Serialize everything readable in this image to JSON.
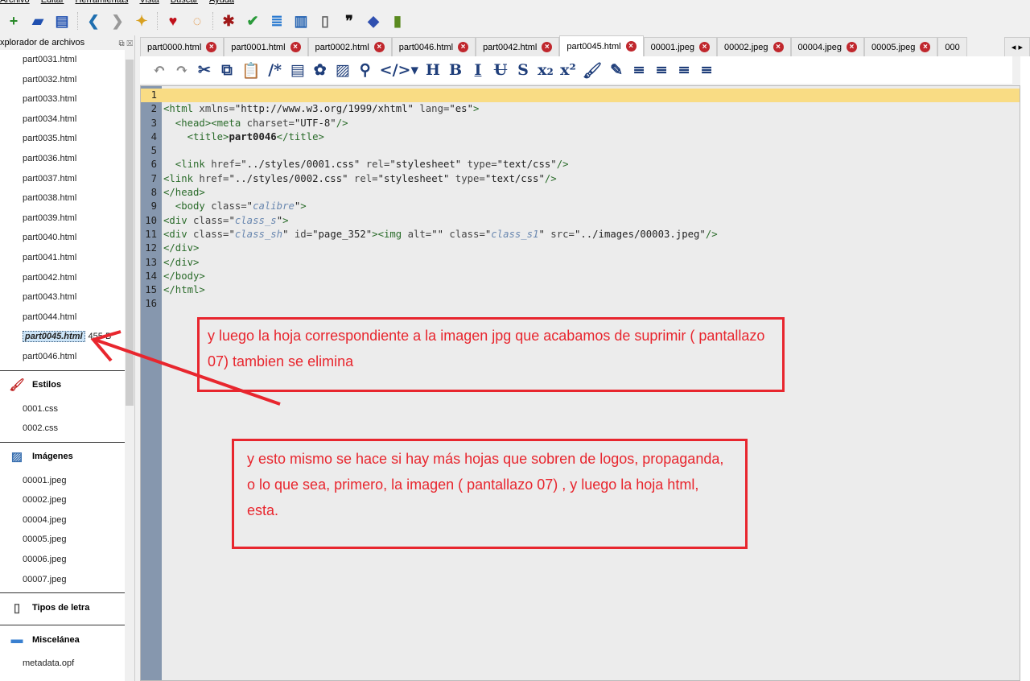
{
  "menu": [
    "Archivo",
    "Editar",
    "Herramientas",
    "Vista",
    "Buscar",
    "Ayuda"
  ],
  "toolbar": [
    {
      "icon": "new-file",
      "g": "+",
      "c": "#2a8a2a"
    },
    {
      "icon": "open-folder",
      "g": "▰",
      "c": "#2050b0"
    },
    {
      "icon": "save",
      "g": "▤",
      "c": "#2050b0"
    },
    {
      "icon": "back",
      "g": "❮",
      "c": "#1f6fb0"
    },
    {
      "icon": "forward",
      "g": "❯",
      "c": "#999"
    },
    {
      "icon": "pin",
      "g": "✦",
      "c": "#d8a020"
    },
    {
      "icon": "heart",
      "g": "♥",
      "c": "#c0101a"
    },
    {
      "icon": "lifebuoy",
      "g": "◌",
      "c": "#e08a30"
    },
    {
      "icon": "bug",
      "g": "✱",
      "c": "#a01818"
    },
    {
      "icon": "spellcheck",
      "g": "✔",
      "c": "#2a9a3a"
    },
    {
      "icon": "toc",
      "g": "≣",
      "c": "#2a7ad0"
    },
    {
      "icon": "book",
      "g": "▥",
      "c": "#2060b0"
    },
    {
      "icon": "font-file",
      "g": "▯",
      "c": "#666"
    },
    {
      "icon": "quote",
      "g": "❞",
      "c": "#111"
    },
    {
      "icon": "eraser",
      "g": "◆",
      "c": "#3050b0"
    },
    {
      "icon": "reports",
      "g": "▮",
      "c": "#5a8a20"
    }
  ],
  "sidebar": {
    "title": "xplorador de archivos",
    "html_files": [
      "part0031.html",
      "part0032.html",
      "part0033.html",
      "part0034.html",
      "part0035.html",
      "part0036.html",
      "part0037.html",
      "part0038.html",
      "part0039.html",
      "part0040.html",
      "part0041.html",
      "part0042.html",
      "part0043.html",
      "part0044.html"
    ],
    "selected": {
      "name": "part0045.html",
      "size": "455 B"
    },
    "after_selected": "part0046.html",
    "styles_label": "Estilos",
    "styles": [
      "0001.css",
      "0002.css"
    ],
    "images_label": "Imágenes",
    "images": [
      "00001.jpeg",
      "00002.jpeg",
      "00004.jpeg",
      "00005.jpeg",
      "00006.jpeg",
      "00007.jpeg"
    ],
    "fonts_label": "Tipos de letra",
    "misc_label": "Miscelánea",
    "misc": [
      "metadata.opf"
    ]
  },
  "tabs": [
    {
      "label": "part0000.html"
    },
    {
      "label": "part0001.html"
    },
    {
      "label": "part0002.html"
    },
    {
      "label": "part0046.html"
    },
    {
      "label": "part0042.html"
    },
    {
      "label": "part0045.html",
      "active": true
    },
    {
      "label": "00001.jpeg"
    },
    {
      "label": "00002.jpeg"
    },
    {
      "label": "00004.jpeg"
    },
    {
      "label": "00005.jpeg"
    },
    {
      "label": "000"
    }
  ],
  "editor_toolbar": [
    "↶",
    "↷",
    "✂",
    "⧉",
    "📋",
    "/*",
    "▤",
    "✿",
    "▨",
    "⚲",
    "</>▾",
    "H",
    "B",
    "I",
    "U",
    "S",
    "x₂",
    "x²",
    "🖌",
    "✎",
    "≡",
    "≡",
    "≡",
    "≡"
  ],
  "editor_toolbar_names": [
    "undo",
    "redo",
    "cut",
    "copy",
    "paste",
    "comment",
    "html",
    "flower",
    "image",
    "link",
    "code",
    "heading",
    "bold",
    "italic",
    "underline",
    "strikethrough",
    "subscript",
    "superscript",
    "brush",
    "clear-format",
    "align-left",
    "align-center",
    "align-right",
    "justify"
  ],
  "notes": [
    "y luego la hoja correspondiente a la imagen jpg que acabamos de suprimir  ( pantallazo 07)    tambien se elimina",
    "y esto mismo se hace si hay más hojas que sobren de logos, propaganda, o lo que sea, primero, la imagen ( pantallazo 07)   , y luego la hoja html, esta."
  ],
  "colors": {
    "annotation": "#e8262e",
    "current_line": "#f9dc84",
    "gutter": "#8697ae"
  }
}
